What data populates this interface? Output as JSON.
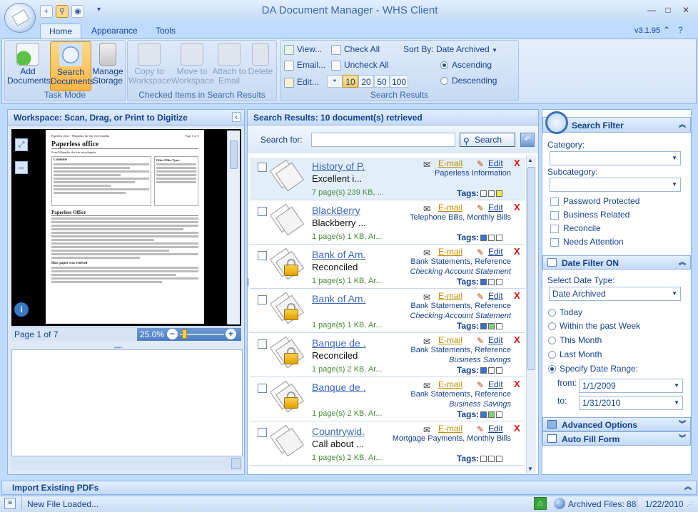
{
  "window": {
    "title": "DA Document Manager - WHS Client",
    "version": "v3.1.95"
  },
  "tabs": [
    {
      "label": "Home"
    },
    {
      "label": "Appearance"
    },
    {
      "label": "Tools"
    }
  ],
  "ribbon": {
    "task_mode": {
      "label": "Task Mode",
      "buttons": [
        {
          "label": "Add Documents"
        },
        {
          "label": "Search Documents"
        },
        {
          "label": "Manage Storage"
        }
      ]
    },
    "checked_items": {
      "label": "Checked Items in Search Results",
      "buttons": [
        {
          "label": "Copy to Workspace"
        },
        {
          "label": "Move to Workspace"
        },
        {
          "label": "Attach to Email"
        },
        {
          "label": "Delete"
        }
      ]
    },
    "search_results": {
      "label": "Search Results",
      "view": "View...",
      "email": "Email...",
      "edit": "Edit...",
      "check_all": "Check All",
      "uncheck_all": "Uncheck All",
      "page_sizes": [
        "*",
        "10",
        "20",
        "50",
        "100"
      ],
      "sort_by_label": "Sort By:",
      "sort_by_value": "Date Archived",
      "ascending": "Ascending",
      "descending": "Descending"
    }
  },
  "workspace": {
    "title": "Workspace:  Scan, Drag, or Print to Digitize",
    "page_indicator": "Page 1 of 7",
    "zoom": "25.0%",
    "doc_title": "Paperless office",
    "doc_header_left": "Paperless office - Wikipedia, the free encyclopedia",
    "doc_header_right": "Page 1 of 5",
    "doc_tagline": "From Wikipedia, the free encyclopedia",
    "doc_contents": "Contents",
    "doc_section": "Paperless Office",
    "doc_section2": "How paper was evolved",
    "doc_sidebar_title": "Other Office Types"
  },
  "search_results": {
    "title": "Search Results:  10 document(s) retrieved",
    "search_for_label": "Search for:",
    "search_value": "",
    "search_button": "Search",
    "email_label": "E-mail",
    "edit_label": "Edit",
    "delete_label": "X",
    "tags_label": "Tags:",
    "items": [
      {
        "name": "History of P.",
        "subtitle": "Excellent i...",
        "meta": "7 page(s) 239 KB, ...",
        "category": "Paperless Information",
        "subcategory": "",
        "locked": false,
        "tag_colors": [
          "#ffffff",
          "#ffffff",
          "#f7e84a"
        ]
      },
      {
        "name": "BlackBerry",
        "subtitle": "Blackberry ...",
        "meta": "1 page(s) 1 KB, Ar...",
        "category": "Telephone Bills, Monthly Bills",
        "subcategory": "",
        "locked": false,
        "tag_colors": [
          "#3b6fd0",
          "#ffffff",
          "#ffffff"
        ]
      },
      {
        "name": "Bank of Am.",
        "subtitle": "Reconciled",
        "meta": "1 page(s) 1 KB, Ar...",
        "category": "Bank Statements, Reference",
        "subcategory": "Checking Account Statement",
        "locked": true,
        "tag_colors": [
          "#3b6fd0",
          "#ffffff",
          "#ffffff"
        ]
      },
      {
        "name": "Bank of Am.",
        "subtitle": "",
        "meta": "1 page(s) 1 KB, Ar...",
        "category": "Bank Statements, Reference",
        "subcategory": "Checking Account Statement",
        "locked": true,
        "tag_colors": [
          "#3b6fd0",
          "#7ed07e",
          "#ffffff"
        ]
      },
      {
        "name": "Banque de .",
        "subtitle": "Reconciled",
        "meta": "1 page(s) 2 KB, Ar...",
        "category": "Bank Statements, Reference",
        "subcategory": "Business Savings",
        "locked": true,
        "tag_colors": [
          "#3b6fd0",
          "#ffffff",
          "#ffffff"
        ]
      },
      {
        "name": "Banque de .",
        "subtitle": "",
        "meta": "1 page(s) 2 KB, Ar...",
        "category": "Bank Statements, Reference",
        "subcategory": "Business Savings",
        "locked": true,
        "tag_colors": [
          "#3b6fd0",
          "#7ed07e",
          "#ffffff"
        ]
      },
      {
        "name": "Countrywid.",
        "subtitle": "Call about ...",
        "meta": "1 page(s) 2 KB, Ar...",
        "category": "Mortgage Payments, Monthly Bills",
        "subcategory": "",
        "locked": false,
        "tag_colors": [
          "#ffffff",
          "#ffffff",
          "#ffffff"
        ]
      }
    ]
  },
  "search_filter": {
    "title": "Search Filter",
    "category_label": "Category:",
    "category_value": "",
    "subcategory_label": "Subcategory:",
    "subcategory_value": "",
    "checkboxes": [
      {
        "label": "Password Protected"
      },
      {
        "label": "Business Related"
      },
      {
        "label": "Reconcile"
      },
      {
        "label": "Needs Attention"
      }
    ]
  },
  "date_filter": {
    "title": "Date Filter ON",
    "date_type_label": "Select Date Type:",
    "date_type_value": "Date Archived",
    "options": [
      {
        "label": "Today",
        "selected": false
      },
      {
        "label": "Within the past Week",
        "selected": false
      },
      {
        "label": "This Month",
        "selected": false
      },
      {
        "label": "Last Month",
        "selected": false
      },
      {
        "label": "Specify Date Range:",
        "selected": true
      }
    ],
    "from_label": "from:",
    "from_value": "1/1/2009",
    "to_label": "to:",
    "to_value": "1/31/2010"
  },
  "advanced_options": "Advanced Options",
  "auto_fill_form": "Auto Fill Form",
  "import_bar": "Import Existing PDFs",
  "status": {
    "message": "New File Loaded...",
    "archived": "Archived Files: 88",
    "date": "1/22/2010"
  }
}
